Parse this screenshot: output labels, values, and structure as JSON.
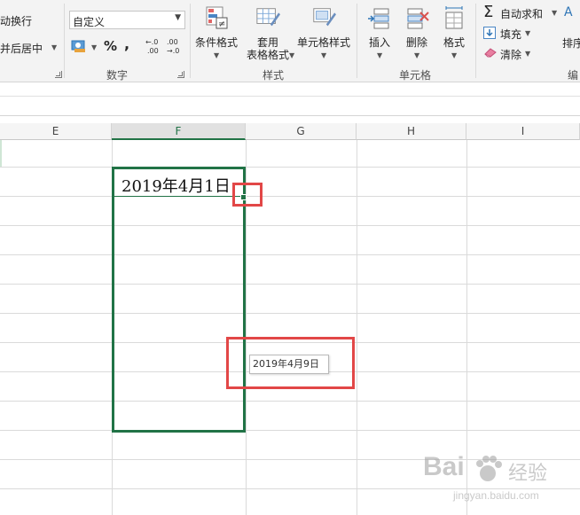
{
  "ribbon": {
    "alignment": {
      "wrap_text": "动换行",
      "merge_center": "并后居中"
    },
    "number": {
      "format_value": "自定义",
      "percent": "%",
      "comma": ",",
      "inc_decimal": "←.0\n.00",
      "dec_decimal": ".00\n→.0",
      "group_label": "数字"
    },
    "styles": {
      "conditional_format": "条件格式",
      "table_format_line1": "套用",
      "table_format_line2": "表格格式",
      "cell_styles": "单元格样式",
      "group_label": "样式"
    },
    "cells": {
      "insert": "插入",
      "delete": "删除",
      "format": "格式",
      "group_label": "单元格"
    },
    "editing": {
      "autosum": "自动求和",
      "fill": "填充",
      "clear": "清除",
      "sort": "排序",
      "group_label": "编"
    }
  },
  "columns": [
    "E",
    "F",
    "G",
    "H",
    "I"
  ],
  "selected_column": "F",
  "cell": {
    "value": "2019年4月1日"
  },
  "fill_tooltip": "2019年4月9日",
  "watermark": {
    "brand": "Bai",
    "brand2": "经验",
    "url": "jingyan.baidu.com"
  },
  "colors": {
    "accent": "#217346",
    "highlight": "#e24747",
    "ribbon_bg": "#f3f3f3"
  }
}
